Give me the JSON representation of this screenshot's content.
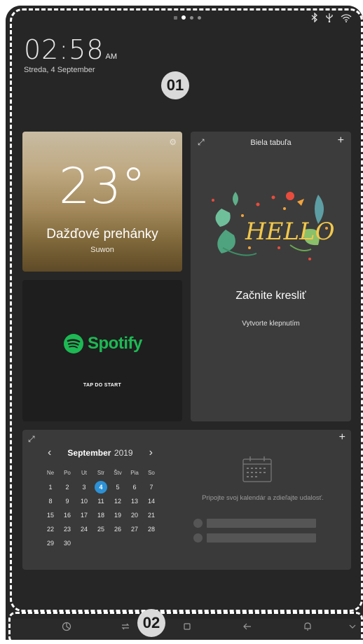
{
  "status_bar": {
    "icons": [
      "bluetooth-icon",
      "usb-icon",
      "wifi-icon"
    ]
  },
  "clock": {
    "time": "02:58",
    "ampm": "AM",
    "date": "Streda, 4 September"
  },
  "annotations": {
    "region_1": "01",
    "region_2": "02"
  },
  "weather": {
    "temperature": "23°",
    "condition": "Dažďové prehánky",
    "location": "Suwon"
  },
  "spotify": {
    "logo_text": "Spotify",
    "tap_label": "TAP DO START"
  },
  "whiteboard": {
    "title": "Biela tabuľa",
    "artwork_text": "HELLO",
    "start_label": "Začnite kresliť",
    "sub_label": "Vytvorte klepnutím"
  },
  "calendar": {
    "month": "September",
    "year": "2019",
    "weekdays": [
      "Ne",
      "Po",
      "Ut",
      "Str",
      "Štv",
      "Pia",
      "So"
    ],
    "weeks": [
      [
        "1",
        "2",
        "3",
        "4",
        "5",
        "6",
        "7"
      ],
      [
        "8",
        "9",
        "10",
        "11",
        "12",
        "13",
        "14"
      ],
      [
        "15",
        "16",
        "17",
        "18",
        "19",
        "20",
        "21"
      ],
      [
        "22",
        "23",
        "24",
        "25",
        "26",
        "27",
        "28"
      ],
      [
        "29",
        "30",
        "",
        "",
        "",
        "",
        ""
      ]
    ],
    "today": "4",
    "today_color": "#2c91d6",
    "empty_message": "Pripojte svoj kalendár a zdieľajte udalosť."
  },
  "nav_bar": {
    "buttons": [
      "apps-icon",
      "recents-icon",
      "home-icon",
      "back-icon",
      "notification-icon",
      "collapse-icon"
    ]
  },
  "colors": {
    "background": "#262626",
    "spotify_green": "#1db954",
    "accent_blue": "#2c91d6"
  }
}
